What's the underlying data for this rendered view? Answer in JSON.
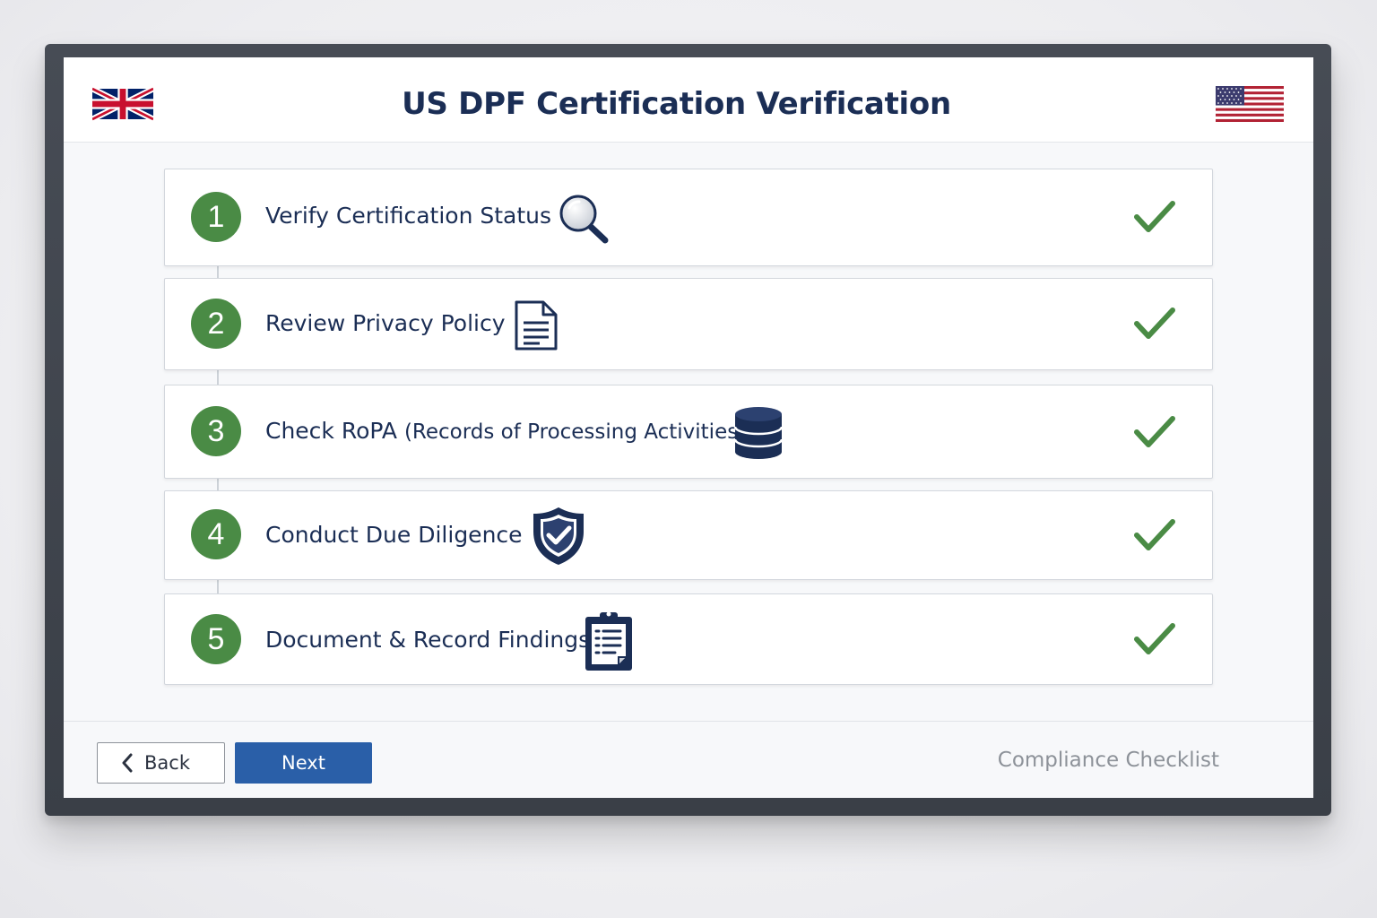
{
  "title": "US DPF Certification Verification",
  "flags": {
    "left": "uk-flag-icon",
    "right": "us-flag-icon"
  },
  "steps": [
    {
      "number": "1",
      "label": "Verify Certification Status",
      "icon": "magnifier-icon",
      "status": "complete"
    },
    {
      "number": "2",
      "label": "Review Privacy Policy",
      "icon": "document-icon",
      "status": "complete"
    },
    {
      "number": "3",
      "label": "Check RoPA",
      "label_paren": "(Records of Processing Activities)",
      "icon": "database-icon",
      "status": "complete"
    },
    {
      "number": "4",
      "label": "Conduct Due Diligence",
      "icon": "shield-check-icon",
      "status": "complete"
    },
    {
      "number": "5",
      "label": "Document & Record Findings",
      "icon": "clipboard-icon",
      "status": "complete"
    }
  ],
  "footer": {
    "back_label": "Back",
    "next_label": "Next",
    "right_label": "Compliance Checklist"
  },
  "colors": {
    "title": "#1b2e55",
    "step_number_bg": "#4a8b45",
    "check": "#4a8b45",
    "next_button": "#2a5fa8",
    "bezel": "#3e434b"
  }
}
